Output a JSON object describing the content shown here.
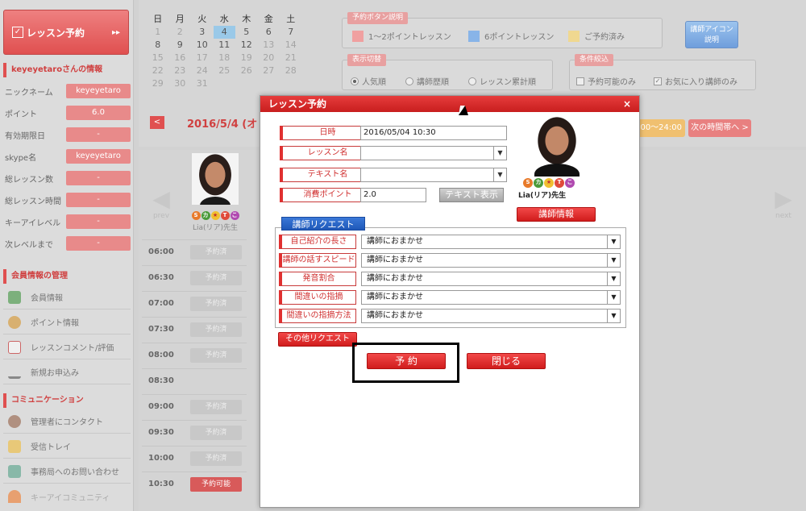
{
  "sidebar": {
    "lesson_button": "レッスン予約",
    "lesson_arrow": "▸▸",
    "user_info_title": "keyeyetaroさんの情報",
    "info_rows": [
      {
        "label": "ニックネーム",
        "value": "keyeyetaro"
      },
      {
        "label": "ポイント",
        "value": "6.0"
      },
      {
        "label": "有効期限日",
        "value": "-"
      },
      {
        "label": "skype名",
        "value": "keyeyetaro"
      },
      {
        "label": "総レッスン数",
        "value": "-"
      },
      {
        "label": "総レッスン時間",
        "value": "-"
      },
      {
        "label": "キーアイレベル",
        "value": "-"
      },
      {
        "label": "次レベルまで",
        "value": "-"
      }
    ],
    "member_title": "会員情報の管理",
    "member_items": [
      "会員情報",
      "ポイント情報",
      "レッスンコメント/評価",
      "新規お申込み"
    ],
    "comm_title": "コミュニケーション",
    "comm_items": [
      "管理者にコンタクト",
      "受信トレイ",
      "事務局へのお問い合わせ",
      "キーアイコミュニティ"
    ]
  },
  "calendar": {
    "weekdays": [
      "日",
      "月",
      "火",
      "水",
      "木",
      "金",
      "土"
    ],
    "rows": [
      [
        "1",
        "2",
        "3",
        "4",
        "5",
        "6",
        "7"
      ],
      [
        "8",
        "9",
        "10",
        "11",
        "12",
        "13",
        "14"
      ],
      [
        "15",
        "16",
        "17",
        "18",
        "19",
        "20",
        "21"
      ],
      [
        "22",
        "23",
        "24",
        "25",
        "26",
        "27",
        "28"
      ],
      [
        "29",
        "30",
        "31",
        "",
        "",
        "",
        ""
      ]
    ],
    "selected": "4",
    "current_date": "2016/5/4 (オ",
    "prev_arrow": "<"
  },
  "legend": {
    "title": "予約ボタン説明",
    "items": [
      {
        "label": "1〜2ポイントレッスン",
        "color": "#f0a0a0"
      },
      {
        "label": "6ポイントレッスン",
        "color": "#88b4e8"
      },
      {
        "label": "ご予約済み",
        "color": "#f0d890"
      }
    ],
    "icon_button_l1": "講師アイコン",
    "icon_button_l2": "説明"
  },
  "display": {
    "title": "表示切替",
    "options": [
      "人気順",
      "講師歴順",
      "レッスン累計順"
    ]
  },
  "filter": {
    "title": "条件絞込",
    "options": [
      "予約可能のみ",
      "お気に入り講師のみ"
    ]
  },
  "time_nav": {
    "range": "00〜24:00",
    "next": "次の時間帯へ >"
  },
  "schedule": {
    "teacher_name": "Lia(リア)先生",
    "prev": "prev",
    "next": "next",
    "slots": [
      {
        "time": "06:00",
        "status": "予約済"
      },
      {
        "time": "06:30",
        "status": "予約済"
      },
      {
        "time": "07:00",
        "status": "予約済"
      },
      {
        "time": "07:30",
        "status": "予約済"
      },
      {
        "time": "08:00",
        "status": "予約済"
      },
      {
        "time": "08:30",
        "status": ""
      },
      {
        "time": "09:00",
        "status": "予約済"
      },
      {
        "time": "09:30",
        "status": "予約済"
      },
      {
        "time": "10:00",
        "status": "予約済"
      },
      {
        "time": "10:30",
        "status": "予約可能"
      }
    ]
  },
  "modal": {
    "title": "レッスン予約",
    "close_x": "×",
    "fields": {
      "datetime_label": "日時",
      "datetime_value": "2016/05/04 10:30",
      "lesson_label": "レッスン名",
      "lesson_value": "",
      "text_label": "テキスト名",
      "text_value": "",
      "points_label": "消費ポイント",
      "points_value": "2.0",
      "text_show_button": "テキスト表示"
    },
    "teacher": {
      "name": "Lia(リア)先生",
      "info_button": "講師情報",
      "badges": [
        "S",
        "カ",
        "★",
        "T",
        "こ"
      ]
    },
    "request_tab": "講師リクエスト",
    "requests": [
      {
        "label": "自己紹介の長さ",
        "value": "講師におまかせ"
      },
      {
        "label": "講師の話すスピード",
        "value": "講師におまかせ"
      },
      {
        "label": "発音割合",
        "value": "講師におまかせ"
      },
      {
        "label": "間違いの指摘",
        "value": "講師におまかせ"
      },
      {
        "label": "間違いの指摘方法",
        "value": "講師におまかせ"
      }
    ],
    "other_request": "その他リクエスト",
    "reserve_button": "予 約",
    "close_button": "閉じる"
  },
  "colors": {
    "accent": "#e03030",
    "request_blue": "#2060c0"
  }
}
